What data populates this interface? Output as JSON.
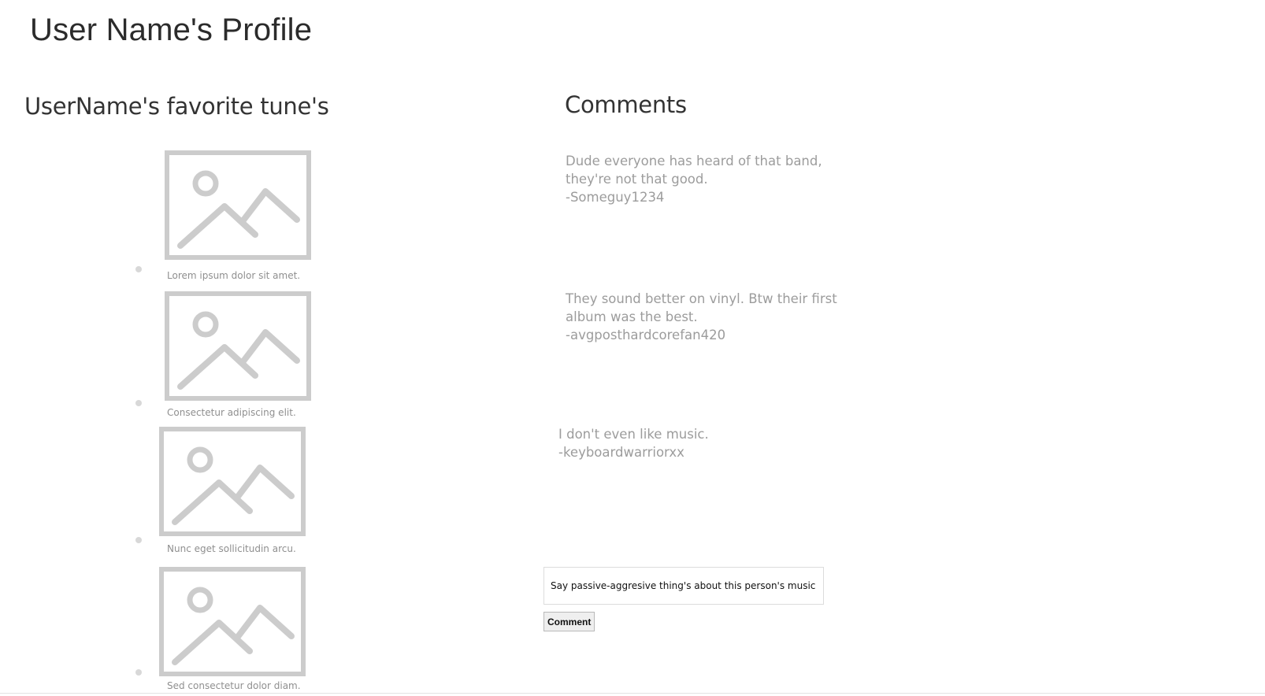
{
  "page": {
    "title": "User Name's Profile"
  },
  "tunes": {
    "heading": "UserName's favorite tune's",
    "items": [
      {
        "caption": "Lorem ipsum dolor sit amet.",
        "icon": "image-placeholder-icon"
      },
      {
        "caption": "Consectetur adipiscing elit.",
        "icon": "image-placeholder-icon"
      },
      {
        "caption": "Nunc eget sollicitudin arcu.",
        "icon": "image-placeholder-icon"
      },
      {
        "caption": "Sed consectetur dolor diam.",
        "icon": "image-placeholder-icon"
      }
    ]
  },
  "comments": {
    "heading": "Comments",
    "items": [
      {
        "lines": [
          "Dude everyone has heard of that band,",
          "they're not that good."
        ],
        "author": "-Someguy1234"
      },
      {
        "lines": [
          "They sound better on vinyl. Btw their first",
          "album was the best."
        ],
        "author": "-avgposthardcorefan420"
      },
      {
        "lines": [
          "I don't even like music."
        ],
        "author": "-keyboardwarriorxx"
      }
    ],
    "input": {
      "placeholder": "Say passive-aggresive thing's about this person's music here!"
    },
    "submit_label": "Comment"
  },
  "colors": {
    "placeholder_image": "#cccccc",
    "heading_text": "#333333",
    "comment_text": "#9c9c9c",
    "caption_text": "#8f8f8f"
  }
}
